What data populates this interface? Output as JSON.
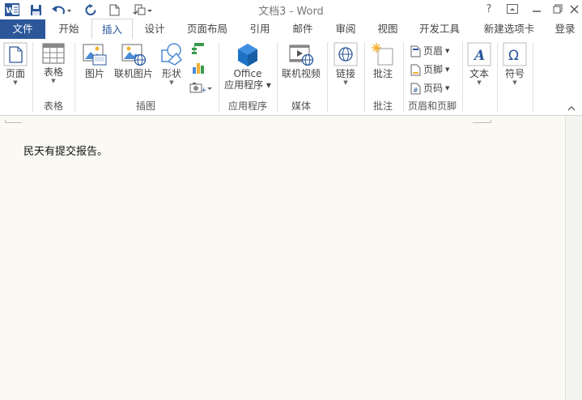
{
  "window": {
    "title": "文档3 - Word",
    "help": "?",
    "user_login": "登录"
  },
  "tabs": [
    {
      "label": "文件"
    },
    {
      "label": "开始"
    },
    {
      "label": "插入"
    },
    {
      "label": "设计"
    },
    {
      "label": "页面布局"
    },
    {
      "label": "引用"
    },
    {
      "label": "邮件"
    },
    {
      "label": "审阅"
    },
    {
      "label": "视图"
    },
    {
      "label": "开发工具"
    },
    {
      "label": "新建选项卡"
    }
  ],
  "ribbon": {
    "pages": {
      "button": "页面"
    },
    "tables": {
      "button": "表格",
      "group": "表格"
    },
    "illustrations": {
      "picture": "图片",
      "online_picture": "联机图片",
      "shapes": "形状",
      "group": "插图"
    },
    "apps": {
      "office_line1": "Office",
      "office_line2": "应用程序",
      "group": "应用程序"
    },
    "media": {
      "online_video": "联机视频",
      "group": "媒体"
    },
    "links": {
      "button": "链接"
    },
    "comments": {
      "button": "批注",
      "group": "批注"
    },
    "header_footer": {
      "header": "页眉",
      "footer": "页脚",
      "page_number": "页码",
      "group": "页眉和页脚"
    },
    "text": {
      "button": "文本"
    },
    "symbols": {
      "button": "符号"
    }
  },
  "document": {
    "body_text": "民天有提交报告。"
  },
  "colors": {
    "accent": "#2b579a",
    "page_bg": "#faf9f3"
  }
}
